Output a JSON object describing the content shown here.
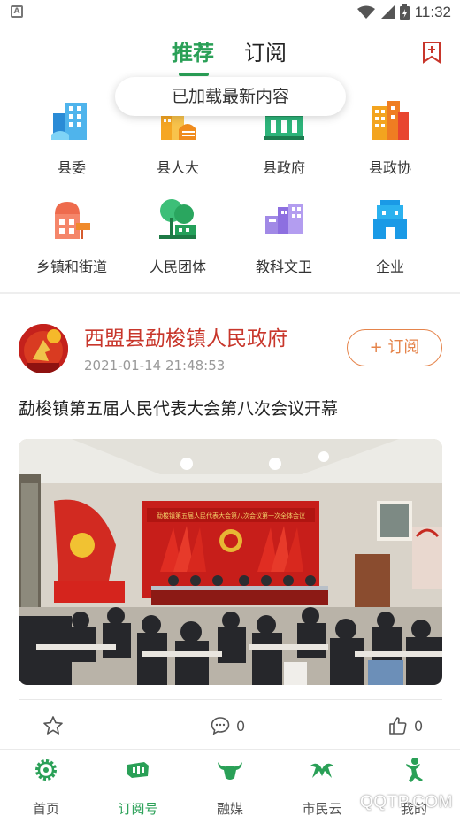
{
  "status_bar": {
    "time": "11:32"
  },
  "top_tabs": {
    "recommended": "推荐",
    "subscribed": "订阅"
  },
  "toast": "已加载最新内容",
  "categories": [
    {
      "label": "县委",
      "icon": "county-committee-icon"
    },
    {
      "label": "县人大",
      "icon": "peoples-congress-icon"
    },
    {
      "label": "县政府",
      "icon": "county-government-icon"
    },
    {
      "label": "县政协",
      "icon": "cppcc-icon"
    },
    {
      "label": "乡镇和街道",
      "icon": "township-icon"
    },
    {
      "label": "人民团体",
      "icon": "peoples-groups-icon"
    },
    {
      "label": "教科文卫",
      "icon": "education-science-icon"
    },
    {
      "label": "企业",
      "icon": "enterprise-icon"
    }
  ],
  "post": {
    "org_name": "西盟县勐梭镇人民政府",
    "time": "2021-01-14 21:48:53",
    "subscribe_label": "+ 订阅",
    "title": "勐梭镇第五届人民代表大会第八次会议开幕",
    "photo_banner": "勐梭镇第五届人民代表大会第八次会议第一次全体会议",
    "comment_count": "0",
    "like_count": "0"
  },
  "bottom_nav": [
    {
      "label": "首页",
      "icon": "home-gear-icon",
      "active": false
    },
    {
      "label": "订阅号",
      "icon": "subscription-icon",
      "active": true
    },
    {
      "label": "融媒",
      "icon": "media-bull-icon",
      "active": false
    },
    {
      "label": "市民云",
      "icon": "citizen-cloud-icon",
      "active": false
    },
    {
      "label": "我的",
      "icon": "profile-icon",
      "active": false
    }
  ],
  "watermark": "QQTP.COM",
  "colors": {
    "accent": "#2aa057",
    "org_red": "#c8362b",
    "subscribe_orange": "#e5844b"
  }
}
